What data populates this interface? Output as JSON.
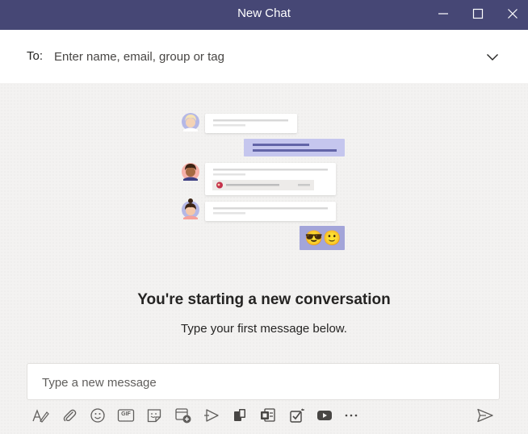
{
  "window": {
    "title": "New Chat",
    "minimize_icon": "minimize-icon",
    "maximize_icon": "maximize-icon",
    "close_icon": "close-icon"
  },
  "to_bar": {
    "label": "To:",
    "placeholder": "Enter name, email, group or tag",
    "dropdown_icon": "chevron-down-icon"
  },
  "empty_state": {
    "heading": "You're starting a new conversation",
    "subheading": "Type your first message below.",
    "reaction_emojis": [
      "😎",
      "🙂"
    ]
  },
  "compose": {
    "placeholder": "Type a new message"
  },
  "toolbar": {
    "items": [
      "format-icon",
      "attach-icon",
      "emoji-icon",
      "gif-icon",
      "sticker-icon",
      "schedule-meeting-icon",
      "stream-icon",
      "app-icon",
      "forms-icon",
      "approvals-icon",
      "youtube-icon",
      "more-options-icon"
    ],
    "gif_label": "GIF",
    "send_icon": "send-icon"
  },
  "colors": {
    "titlebar": "#464775",
    "accent": "#6264a7",
    "bubble_self": "#c5c6ee",
    "background": "#f3f2f1"
  }
}
